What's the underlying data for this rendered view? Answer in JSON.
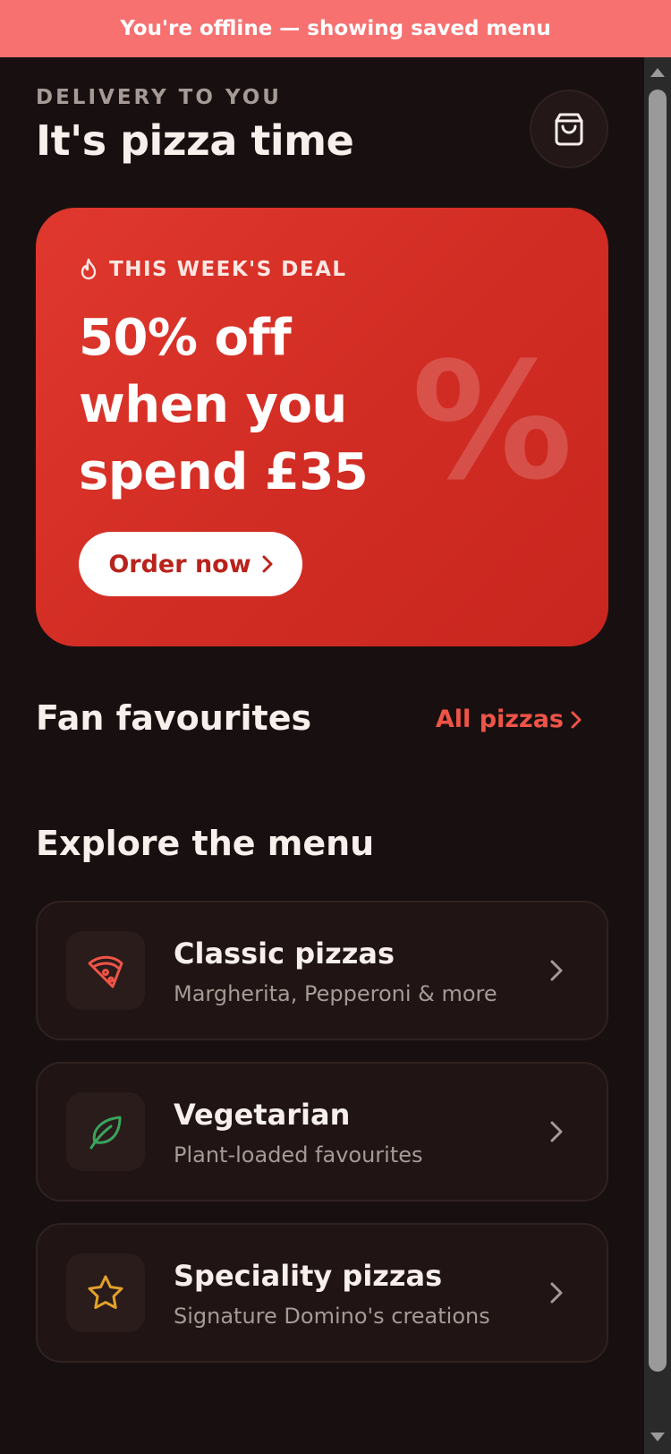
{
  "offline_banner": {
    "text": "You're offline — showing saved menu"
  },
  "header": {
    "eyebrow": "DELIVERY TO YOU",
    "title": "It's pizza time",
    "cart_icon": "shopping-bag-icon"
  },
  "deal": {
    "tag": "THIS WEEK'S DEAL",
    "tag_icon": "flame-icon",
    "headline": "50% off when you spend £35",
    "watermark": "%",
    "cta_label": "Order now",
    "colors": {
      "start": "#e0382e",
      "end": "#c8261f"
    }
  },
  "fan_favourites": {
    "title": "Fan favourites",
    "link_label": "All pizzas"
  },
  "explore": {
    "title": "Explore the menu",
    "items": [
      {
        "title": "Classic pizzas",
        "subtitle": "Margherita, Pepperoni & more",
        "icon": "pizza-slice-icon",
        "icon_color": "#ef5447"
      },
      {
        "title": "Vegetarian",
        "subtitle": "Plant-loaded favourites",
        "icon": "leaf-icon",
        "icon_color": "#3aa45c"
      },
      {
        "title": "Speciality pizzas",
        "subtitle": "Signature Domino's creations",
        "icon": "star-icon",
        "icon_color": "#e2a22a"
      }
    ]
  },
  "colors": {
    "background": "#181010",
    "banner": "#f87171",
    "accent": "#ef5447",
    "card": "#201414"
  }
}
